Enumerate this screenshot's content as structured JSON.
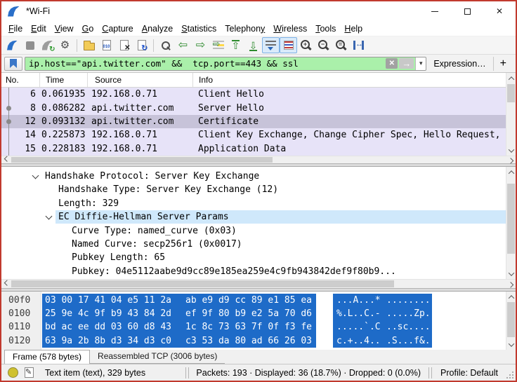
{
  "window": {
    "title": "*Wi-Fi",
    "controls": [
      "minimize-icon",
      "maximize-icon",
      "close-icon"
    ],
    "logo": "wireshark-fin-icon"
  },
  "menu": {
    "items": [
      {
        "label": "File",
        "underline": 0
      },
      {
        "label": "Edit",
        "underline": 0
      },
      {
        "label": "View",
        "underline": 0
      },
      {
        "label": "Go",
        "underline": 0
      },
      {
        "label": "Capture",
        "underline": 0
      },
      {
        "label": "Analyze",
        "underline": 0
      },
      {
        "label": "Statistics",
        "underline": 0
      },
      {
        "label": "Telephony",
        "underline": 8
      },
      {
        "label": "Wireless",
        "underline": 0
      },
      {
        "label": "Tools",
        "underline": 0
      },
      {
        "label": "Help",
        "underline": 0
      }
    ]
  },
  "toolbar": {
    "buttons": [
      {
        "name": "start-capture",
        "icon": "shark-fin"
      },
      {
        "name": "stop-capture",
        "icon": "stop-square"
      },
      {
        "name": "restart-capture",
        "icon": "shark-fin-restart"
      },
      {
        "name": "capture-options",
        "icon": "gear"
      },
      {
        "sep": true
      },
      {
        "name": "open-file",
        "icon": "folder"
      },
      {
        "name": "save-file",
        "icon": "file-save"
      },
      {
        "name": "close-file",
        "icon": "file-close"
      },
      {
        "name": "reload-file",
        "icon": "file-reload"
      },
      {
        "sep": true
      },
      {
        "name": "find-packet",
        "icon": "magnifier"
      },
      {
        "name": "previous-packet",
        "icon": "arrow-left"
      },
      {
        "name": "next-packet",
        "icon": "arrow-right"
      },
      {
        "name": "go-to-packet",
        "icon": "goto"
      },
      {
        "name": "first-packet",
        "icon": "first-up"
      },
      {
        "name": "last-packet",
        "icon": "last-down"
      },
      {
        "name": "auto-scroll",
        "icon": "autoscroll",
        "active": true
      },
      {
        "name": "colorize-packets",
        "icon": "colorize",
        "active": true
      },
      {
        "name": "zoom-in",
        "icon": "zoom-in"
      },
      {
        "name": "zoom-out",
        "icon": "zoom-out"
      },
      {
        "name": "zoom-reset",
        "icon": "zoom-reset"
      },
      {
        "name": "resize-columns",
        "icon": "resize-columns"
      }
    ]
  },
  "filter": {
    "value": "ip.host==\"api.twitter.com\" &&  tcp.port==443 && ssl",
    "expression_label": "Expression…",
    "add_label": "+",
    "icons": [
      "bookmark-icon",
      "clear-icon",
      "apply-icon",
      "dropdown-caret-icon"
    ]
  },
  "packet_list": {
    "columns": [
      "No.",
      "Time",
      "Source",
      "Info"
    ],
    "rows": [
      {
        "no": "6",
        "time": "0.061935",
        "source": "192.168.0.71",
        "info": "Client Hello",
        "related": false,
        "selected": false
      },
      {
        "no": "8",
        "time": "0.086282",
        "source": "api.twitter.com",
        "info": "Server Hello",
        "related": true,
        "selected": false
      },
      {
        "no": "12",
        "time": "0.093132",
        "source": "api.twitter.com",
        "info": "Certificate",
        "related": true,
        "selected": true
      },
      {
        "no": "14",
        "time": "0.225873",
        "source": "192.168.0.71",
        "info": "Client Key Exchange, Change Cipher Spec, Hello Request,",
        "related": false,
        "selected": false
      },
      {
        "no": "15",
        "time": "0.228183",
        "source": "192.168.0.71",
        "info": "Application Data",
        "related": false,
        "selected": false
      }
    ]
  },
  "details": {
    "rows": [
      {
        "indent": 0,
        "expanded": true,
        "selected": false,
        "text": "Handshake Protocol: Server Key Exchange"
      },
      {
        "indent": 1,
        "expanded": false,
        "selected": false,
        "text": "Handshake Type: Server Key Exchange (12)"
      },
      {
        "indent": 1,
        "expanded": false,
        "selected": false,
        "text": "Length: 329"
      },
      {
        "indent": 1,
        "expanded": true,
        "selected": true,
        "text": "EC Diffie-Hellman Server Params"
      },
      {
        "indent": 2,
        "expanded": false,
        "selected": false,
        "text": "Curve Type: named_curve (0x03)"
      },
      {
        "indent": 2,
        "expanded": false,
        "selected": false,
        "text": "Named Curve: secp256r1 (0x0017)"
      },
      {
        "indent": 2,
        "expanded": false,
        "selected": false,
        "text": "Pubkey Length: 65"
      },
      {
        "indent": 2,
        "expanded": false,
        "selected": false,
        "text": "Pubkey: 04e5112aabe9d9cc89e185ea259e4c9fb943842def9f80b9..."
      }
    ]
  },
  "hex": {
    "rows": [
      {
        "offset": "00f0",
        "hex1": "03 00 17 41 04 e5 11 2a",
        "hex2": "ab e9 d9 cc 89 e1 85 ea",
        "ascii1": "...A...*",
        "ascii2": "........"
      },
      {
        "offset": "0100",
        "hex1": "25 9e 4c 9f b9 43 84 2d",
        "hex2": "ef 9f 80 b9 e2 5a 70 d6",
        "ascii1": "%.L..C.-",
        "ascii2": ".....Zp."
      },
      {
        "offset": "0110",
        "hex1": "bd ac ee dd 03 60 d8 43",
        "hex2": "1c 8c 73 63 7f 0f f3 fe",
        "ascii1": ".....`.C",
        "ascii2": "..sc...."
      },
      {
        "offset": "0120",
        "hex1": "63 9a 2b 8b d3 34 d3 c0",
        "hex2": "c3 53 da 80 ad 66 26 03",
        "ascii1": "c.+..4..",
        "ascii2": ".S...f&."
      }
    ]
  },
  "tabs": [
    {
      "label": "Frame (578 bytes)",
      "active": true
    },
    {
      "label": "Reassembled TCP (3006 bytes)",
      "active": false
    }
  ],
  "status": {
    "selection": "Text item (text), 329 bytes",
    "counts": "Packets: 193 · Displayed: 36 (18.7%) · Dropped: 0 (0.0%)",
    "profile": "Profile: Default",
    "icons": [
      "expert-info-icon",
      "capture-comment-icon"
    ]
  },
  "colors": {
    "window_border": "#c13a2e",
    "filter_valid_bg": "#aaf0aa",
    "tls_row_bg": "#e7e3f8",
    "selected_row_bg": "#c7c3d9",
    "detail_selection_bg": "#cfe8fb",
    "hex_selection_bg": "#1e6bc8",
    "accent_pressed_bg": "#d9eafa"
  }
}
